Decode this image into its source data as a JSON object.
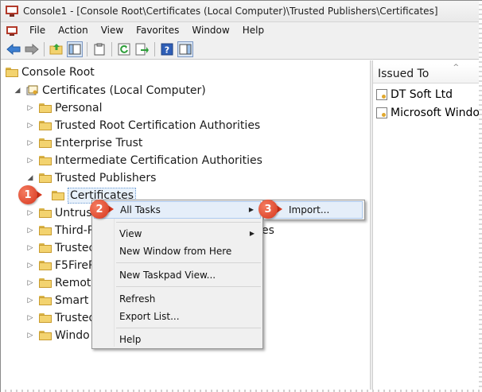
{
  "window": {
    "title": "Console1 - [Console Root\\Certificates (Local Computer)\\Trusted Publishers\\Certificates]"
  },
  "menubar": {
    "items": [
      "File",
      "Action",
      "View",
      "Favorites",
      "Window",
      "Help"
    ]
  },
  "toolbar": {
    "icons": [
      "back-arrow-icon",
      "forward-arrow-icon",
      "up-folder-icon",
      "show-hide-tree-icon",
      "properties-icon",
      "refresh-icon",
      "export-list-icon",
      "help-icon",
      "show-action-pane-icon"
    ]
  },
  "tree": {
    "nodes": [
      {
        "label": "Console Root"
      },
      {
        "label": "Certificates (Local Computer)"
      },
      {
        "label": "Personal"
      },
      {
        "label": "Trusted Root Certification Authorities"
      },
      {
        "label": "Enterprise Trust"
      },
      {
        "label": "Intermediate Certification Authorities"
      },
      {
        "label": "Trusted Publishers"
      },
      {
        "label": "Certificates"
      },
      {
        "label": "Untrus"
      },
      {
        "label": "Third-P"
      },
      {
        "label": "Trustec"
      },
      {
        "label": "F5FireP"
      },
      {
        "label": "Remot"
      },
      {
        "label": "Smart ("
      },
      {
        "label": "Trusted"
      },
      {
        "label": "Windo"
      }
    ],
    "hidden_suffix": "es"
  },
  "list": {
    "column_header": "Issued To",
    "rows": [
      "DT Soft Ltd",
      "Microsoft Windo"
    ]
  },
  "context_menu": {
    "items": {
      "all_tasks": "All Tasks",
      "view": "View",
      "new_window": "New Window from Here",
      "new_taskpad": "New Taskpad View...",
      "refresh": "Refresh",
      "export_list": "Export List...",
      "help": "Help"
    },
    "submenu": {
      "import": "Import..."
    }
  },
  "callouts": [
    "1",
    "2",
    "3"
  ],
  "colors": {
    "callout": "#d7361c",
    "highlight": "#e5eef9",
    "folder": "#f3d36f"
  }
}
